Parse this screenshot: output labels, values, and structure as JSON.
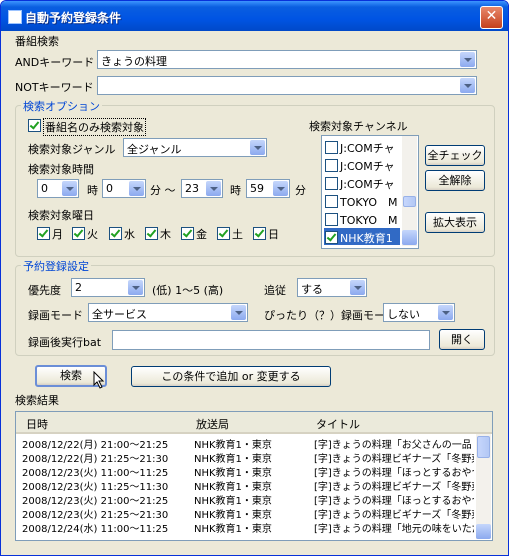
{
  "window": {
    "title": "自動予約登録条件",
    "close": "✕"
  },
  "search": {
    "section_label": "番組検索",
    "and_label": "ANDキーワード",
    "and_value": "きょうの料理",
    "not_label": "NOTキーワード",
    "not_value": ""
  },
  "options": {
    "group_label": "検索オプション",
    "title_only_label": "番組名のみ検索対象",
    "title_only_checked": true,
    "genre_label": "検索対象ジャンル",
    "genre_value": "全ジャンル",
    "time_label": "検索対象時間",
    "start_hour": "0",
    "hour_unit": "時",
    "start_min": "0",
    "min_unit_tilde": "分 〜",
    "end_hour": "23",
    "end_hour_unit": "時",
    "end_min": "59",
    "end_min_unit": "分",
    "weekday_label": "検索対象曜日",
    "weekdays": [
      "月",
      "火",
      "水",
      "木",
      "金",
      "土",
      "日"
    ],
    "channel_label": "検索対象チャンネル",
    "channels": [
      "J:COMチャ",
      "J:COMチャ",
      "J:COMチャ",
      "TOKYO　M",
      "TOKYO　M",
      "NHK教育1"
    ],
    "check_all": "全チェック",
    "clear_all": "全解除",
    "expand": "拡大表示"
  },
  "reserve": {
    "group_label": "予約登録設定",
    "priority_label": "優先度",
    "priority_value": "2",
    "priority_hint": "(低) 1〜5 (高)",
    "follow_label": "追従",
    "follow_value": "する",
    "mode_label": "録画モード",
    "mode_value": "全サービス",
    "exact_label": "ぴったり（？）録画モード",
    "exact_value": "しない",
    "bat_label": "録画後実行bat",
    "bat_value": "",
    "open_button": "開く"
  },
  "actions": {
    "search_button": "検索",
    "add_button": "この条件で追加 or 変更する"
  },
  "results": {
    "section_label": "検索結果",
    "columns": [
      "日時",
      "放送局",
      "タイトル"
    ],
    "rows": [
      [
        "2008/12/22(月) 21:00〜21:25",
        "NHK教育1・東京",
        "[字]きょうの料理「お父さんの一品・"
      ],
      [
        "2008/12/22(月) 21:25〜21:30",
        "NHK教育1・東京",
        "[字]きょうの料理ビギナーズ「冬野菜"
      ],
      [
        "2008/12/23(火) 11:00〜11:25",
        "NHK教育1・東京",
        "[字]きょうの料理「ほっとするおやつ、"
      ],
      [
        "2008/12/23(火) 11:25〜11:30",
        "NHK教育1・東京",
        "[字]きょうの料理ビギナーズ「冬野菜"
      ],
      [
        "2008/12/23(火) 21:00〜21:25",
        "NHK教育1・東京",
        "[字]きょうの料理「ほっとするおやつ、"
      ],
      [
        "2008/12/23(火) 21:25〜21:30",
        "NHK教育1・東京",
        "[字]きょうの料理ビギナーズ「冬野菜"
      ],
      [
        "2008/12/24(水) 11:00〜11:25",
        "NHK教育1・東京",
        "[字]きょうの料理「地元の味をいただ"
      ]
    ]
  }
}
